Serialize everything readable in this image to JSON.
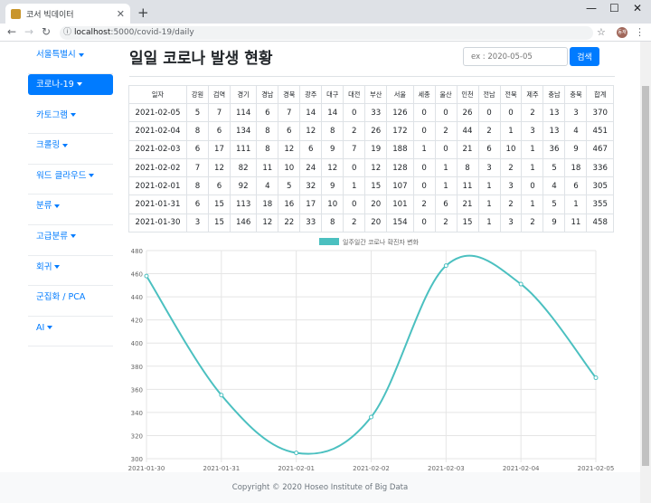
{
  "browser": {
    "tab_title": "코서 빅데이터",
    "url_host": "localhost",
    "url_rest": ":5000/covid-19/daily",
    "profile_label": "동재"
  },
  "sidebar": {
    "items": [
      {
        "label": "서울특별시",
        "caret": true,
        "active": false
      },
      {
        "label": "코로나-19",
        "caret": true,
        "active": true
      },
      {
        "label": "카토그램",
        "caret": true,
        "active": false
      },
      {
        "label": "크롤링",
        "caret": true,
        "active": false
      },
      {
        "label": "워드 클라우드",
        "caret": true,
        "active": false
      },
      {
        "label": "분류",
        "caret": true,
        "active": false
      },
      {
        "label": "고급분류",
        "caret": true,
        "active": false
      },
      {
        "label": "회귀",
        "caret": true,
        "active": false
      },
      {
        "label": "군집화 / PCA",
        "caret": false,
        "active": false
      },
      {
        "label": "AI",
        "caret": true,
        "active": false
      }
    ]
  },
  "main": {
    "title": "일일 코로나 발생 현황",
    "search_placeholder": "ex : 2020-05-05",
    "search_button": "검색"
  },
  "table": {
    "headers": [
      "일자",
      "강원",
      "검역",
      "경기",
      "경남",
      "경북",
      "광주",
      "대구",
      "대전",
      "부산",
      "서울",
      "세종",
      "울산",
      "인천",
      "전남",
      "전북",
      "제주",
      "충남",
      "충북",
      "합계"
    ],
    "rows": [
      [
        "2021-02-05",
        "5",
        "7",
        "114",
        "6",
        "7",
        "14",
        "14",
        "0",
        "33",
        "126",
        "0",
        "0",
        "26",
        "0",
        "0",
        "2",
        "13",
        "3",
        "370"
      ],
      [
        "2021-02-04",
        "8",
        "6",
        "134",
        "8",
        "6",
        "12",
        "8",
        "2",
        "26",
        "172",
        "0",
        "2",
        "44",
        "2",
        "1",
        "3",
        "13",
        "4",
        "451"
      ],
      [
        "2021-02-03",
        "6",
        "17",
        "111",
        "8",
        "12",
        "6",
        "9",
        "7",
        "19",
        "188",
        "1",
        "0",
        "21",
        "6",
        "10",
        "1",
        "36",
        "9",
        "467"
      ],
      [
        "2021-02-02",
        "7",
        "12",
        "82",
        "11",
        "10",
        "24",
        "12",
        "0",
        "12",
        "128",
        "0",
        "1",
        "8",
        "3",
        "2",
        "1",
        "5",
        "18",
        "336"
      ],
      [
        "2021-02-01",
        "8",
        "6",
        "92",
        "4",
        "5",
        "32",
        "9",
        "1",
        "15",
        "107",
        "0",
        "1",
        "11",
        "1",
        "3",
        "0",
        "4",
        "6",
        "305"
      ],
      [
        "2021-01-31",
        "6",
        "15",
        "113",
        "18",
        "16",
        "17",
        "10",
        "0",
        "20",
        "101",
        "2",
        "6",
        "21",
        "1",
        "2",
        "1",
        "5",
        "1",
        "355"
      ],
      [
        "2021-01-30",
        "3",
        "15",
        "146",
        "12",
        "22",
        "33",
        "8",
        "2",
        "20",
        "154",
        "0",
        "2",
        "15",
        "1",
        "3",
        "2",
        "9",
        "11",
        "458"
      ]
    ]
  },
  "chart_data": {
    "type": "line",
    "x": [
      "2021-01-30",
      "2021-01-31",
      "2021-02-01",
      "2021-02-02",
      "2021-02-03",
      "2021-02-04",
      "2021-02-05"
    ],
    "series": [
      {
        "name": "일주일간 코로나 확진자 변화",
        "values": [
          458,
          355,
          305,
          336,
          467,
          451,
          370
        ]
      }
    ],
    "ylim": [
      300,
      480
    ],
    "yticks": [
      300,
      320,
      340,
      360,
      380,
      400,
      420,
      440,
      460,
      480
    ],
    "color": "#4bc0c0",
    "grid": true,
    "legend": "top-center"
  },
  "footer": {
    "text": "Copyright © 2020 Hoseo Institute of Big Data"
  }
}
